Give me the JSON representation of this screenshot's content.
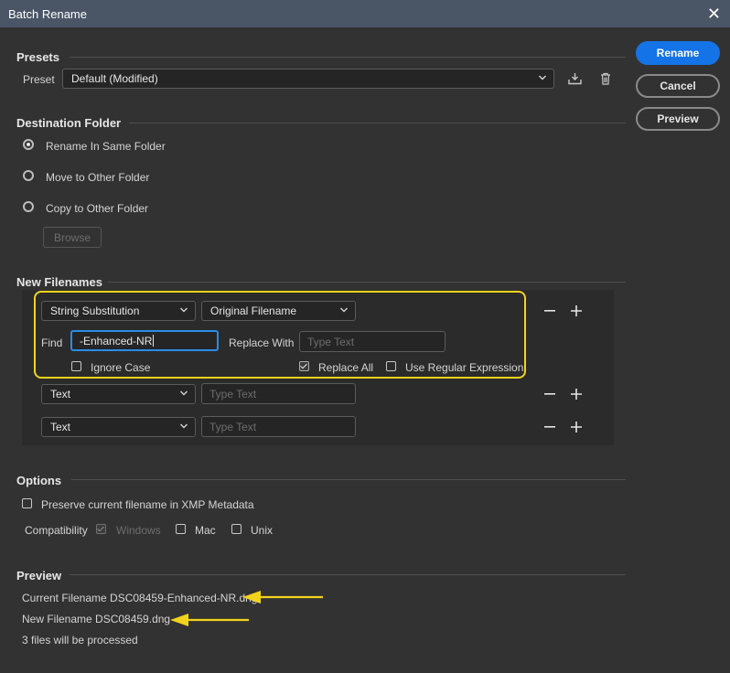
{
  "window": {
    "title": "Batch Rename",
    "close_glyph": "✕"
  },
  "actions": {
    "rename": "Rename",
    "cancel": "Cancel",
    "preview": "Preview"
  },
  "presets": {
    "heading": "Presets",
    "preset_label": "Preset",
    "preset_value": "Default (Modified)",
    "icons": [
      "save-preset-icon",
      "trash-icon"
    ]
  },
  "destination": {
    "heading": "Destination Folder",
    "options": [
      "Rename In Same Folder",
      "Move to Other Folder",
      "Copy to Other Folder"
    ],
    "selected": "Rename In Same Folder",
    "browse": "Browse"
  },
  "new_filenames": {
    "heading": "New Filenames",
    "rows": [
      {
        "type": "String Substitution",
        "source": "Original Filename",
        "find_label": "Find",
        "find_value": "-Enhanced-NR",
        "replace_label": "Replace With",
        "replace_placeholder": "Type Text",
        "ignore_case": "Ignore Case",
        "replace_all": "Replace All",
        "use_regex": "Use Regular Expression"
      },
      {
        "type": "Text",
        "placeholder": "Type Text"
      },
      {
        "type": "Text",
        "placeholder": "Type Text"
      }
    ]
  },
  "options": {
    "heading": "Options",
    "preserve": "Preserve current filename in XMP Metadata",
    "compat_label": "Compatibility",
    "compat": [
      "Windows",
      "Mac",
      "Unix"
    ]
  },
  "preview": {
    "heading": "Preview",
    "current": "Current Filename DSC08459-Enhanced-NR.dng",
    "new": "New Filename DSC08459.dng",
    "count": "3 files will be processed"
  },
  "colors": {
    "accent": "#1473e6",
    "highlight": "#f2d31b",
    "background": "#323232"
  }
}
